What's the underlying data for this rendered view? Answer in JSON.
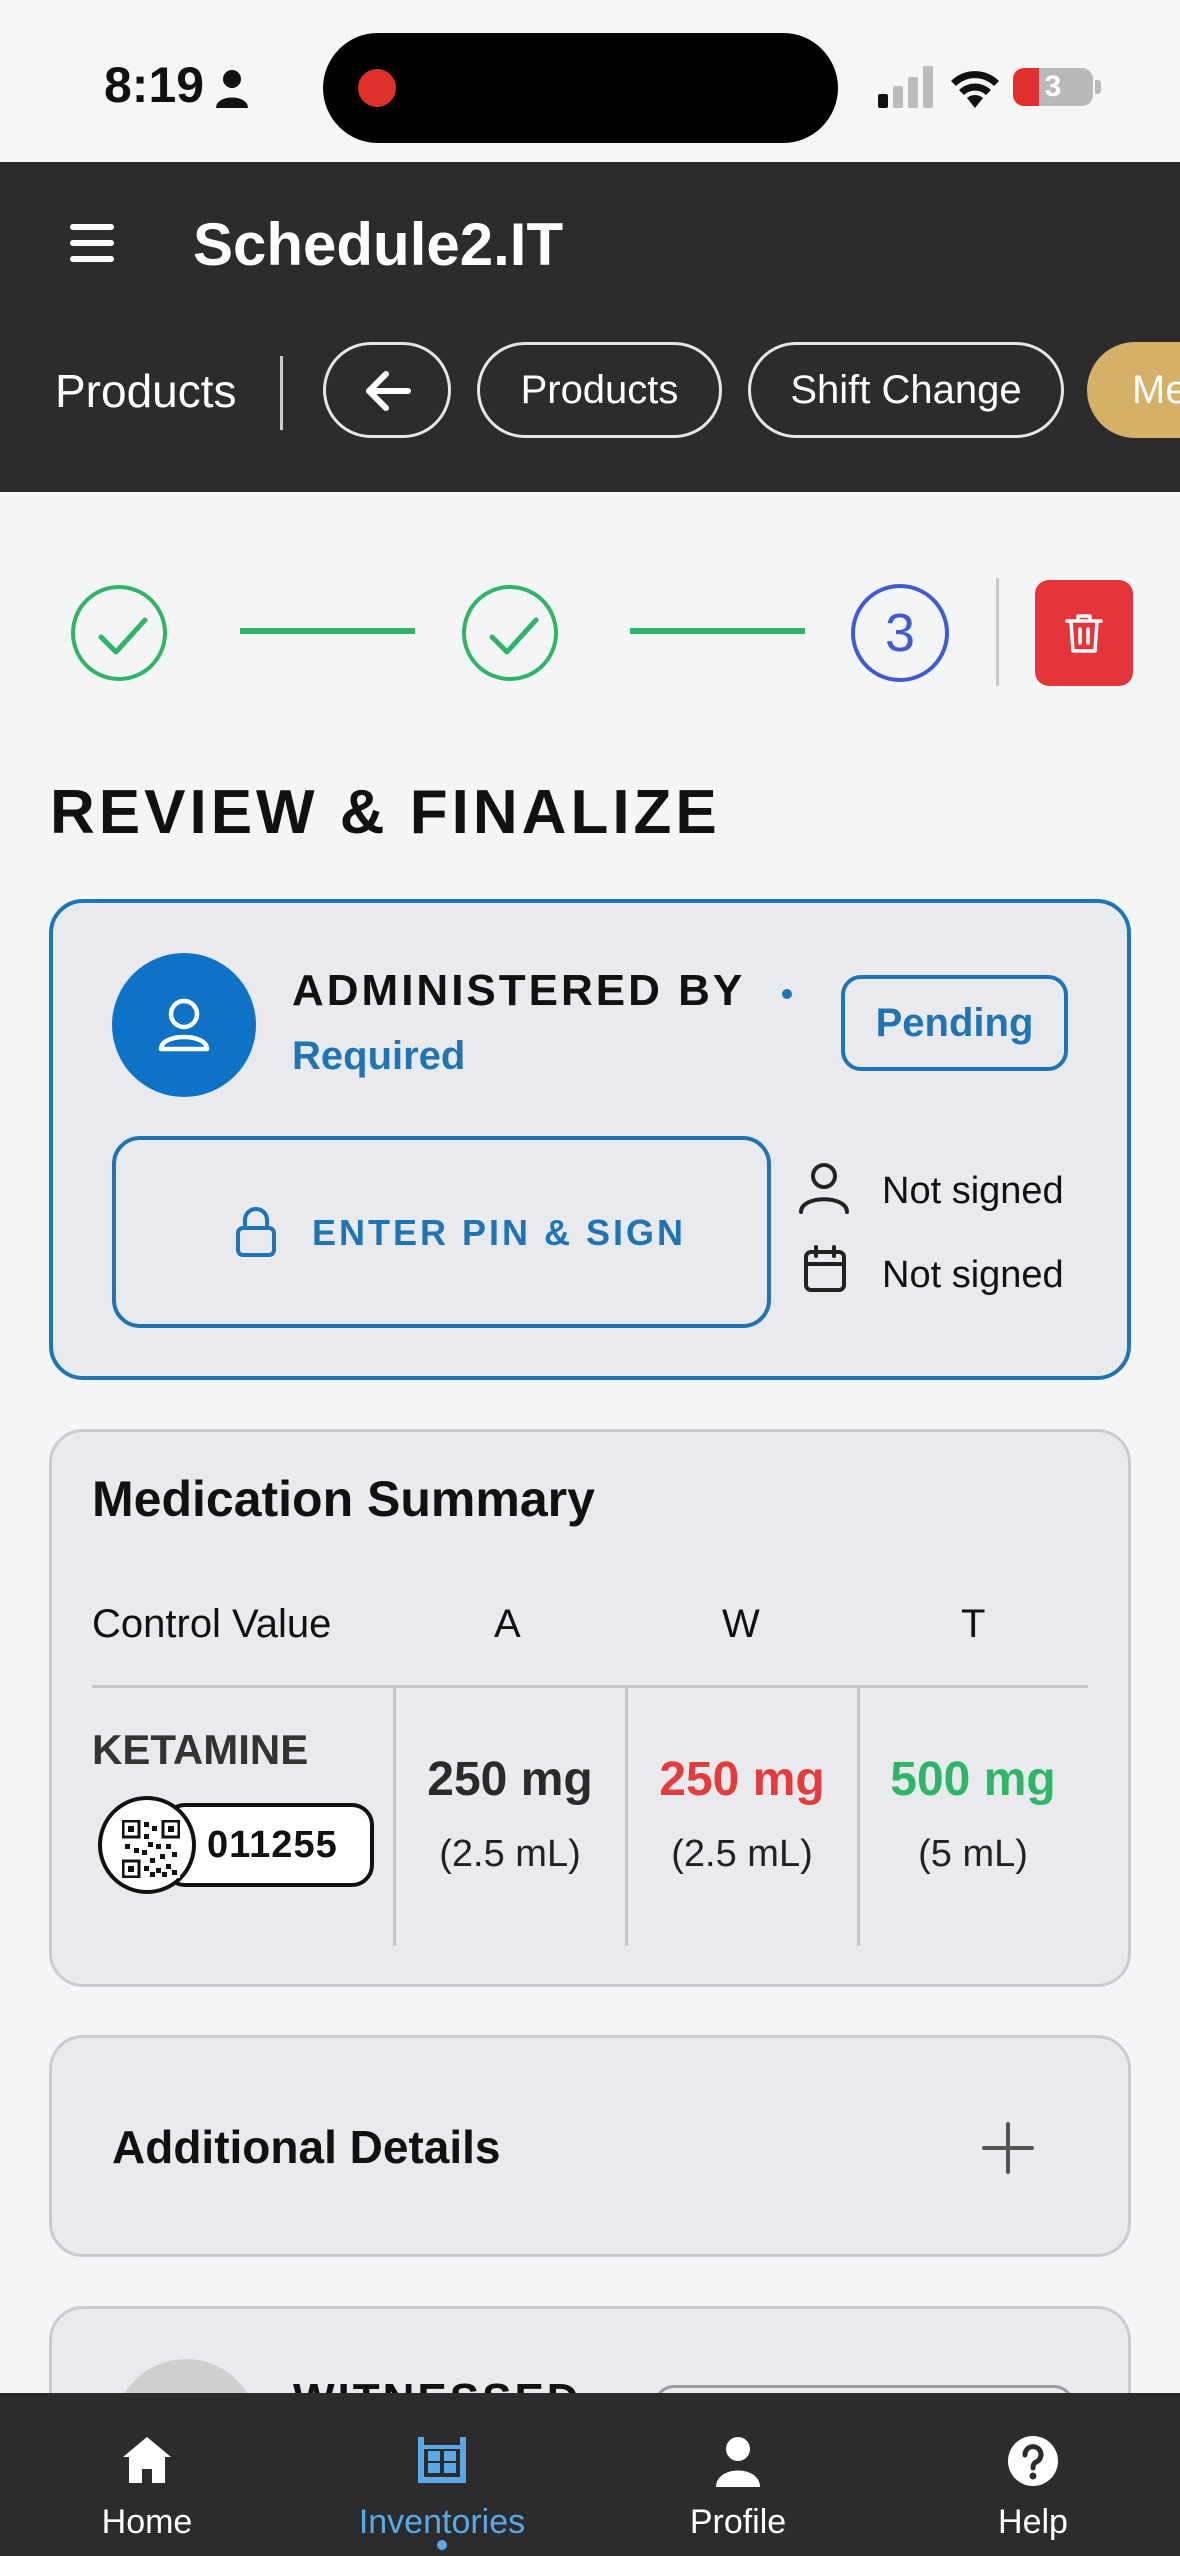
{
  "status_bar": {
    "time": "8:19",
    "battery_level": "3",
    "icons": [
      "person-icon",
      "signal-icon",
      "wifi-icon",
      "battery-icon"
    ],
    "recording_color": "#e0302b"
  },
  "header": {
    "app_title": "Schedule2.IT",
    "section": "Products",
    "nav_pills": [
      {
        "label": "",
        "icon": "arrow-left-icon"
      },
      {
        "label": "Products"
      },
      {
        "label": "Shift Change"
      },
      {
        "label": "Me"
      }
    ],
    "background": "#2c2c2e",
    "accent_pill_color": "#d4b068"
  },
  "stepper": {
    "steps": [
      {
        "state": "complete",
        "icon": "check-icon"
      },
      {
        "state": "complete",
        "icon": "check-icon"
      },
      {
        "state": "current",
        "number": "3"
      }
    ],
    "complete_color": "#2fb565",
    "current_color": "#3e5ad4",
    "delete_icon": "trash-icon",
    "delete_color": "#e4353a"
  },
  "page": {
    "title": "REVIEW & FINALIZE"
  },
  "administered": {
    "heading": "ADMINISTERED BY",
    "required_label": "Required",
    "status_badge": "Pending",
    "sign_button": "ENTER PIN & SIGN",
    "signer_status": "Not signed",
    "date_status": "Not signed",
    "accent_color": "#1f74b4"
  },
  "medication_summary": {
    "title": "Medication Summary",
    "columns": [
      "Control Value",
      "A",
      "W",
      "T"
    ],
    "rows": [
      {
        "drug": "KETAMINE",
        "lot": "011255",
        "a": {
          "amount": "250 mg",
          "volume": "(2.5 mL)"
        },
        "w": {
          "amount": "250 mg",
          "volume": "(2.5 mL)"
        },
        "t": {
          "amount": "500 mg",
          "volume": "(5 mL)"
        }
      }
    ],
    "w_color": "#e23c3c",
    "t_color": "#2fb565"
  },
  "additional_details": {
    "title": "Additional Details",
    "expand_icon": "plus-icon"
  },
  "witnessed": {
    "heading": "WITNESSED"
  },
  "bottom_nav": {
    "items": [
      {
        "label": "Home",
        "icon": "home-icon"
      },
      {
        "label": "Inventories",
        "icon": "inventory-icon",
        "active": true
      },
      {
        "label": "Profile",
        "icon": "profile-icon"
      },
      {
        "label": "Help",
        "icon": "help-icon"
      }
    ],
    "active_color": "#5aa9e6"
  }
}
